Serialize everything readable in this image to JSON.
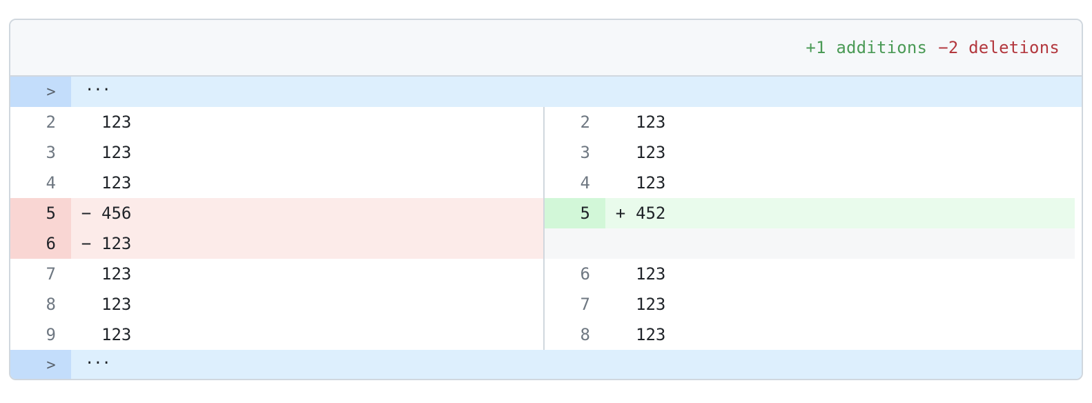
{
  "header": {
    "additions": "+1 additions",
    "deletions": "−2 deletions"
  },
  "hunk_top": {
    "expander": ">",
    "ellipsis": "···"
  },
  "hunk_bottom": {
    "expander": ">",
    "ellipsis": "···"
  },
  "left": [
    {
      "num": "2",
      "sign": "",
      "code": "123",
      "type": "context"
    },
    {
      "num": "3",
      "sign": "",
      "code": "123",
      "type": "context"
    },
    {
      "num": "4",
      "sign": "",
      "code": "123",
      "type": "context"
    },
    {
      "num": "5",
      "sign": "−",
      "code": "456",
      "type": "del"
    },
    {
      "num": "6",
      "sign": "−",
      "code": "123",
      "type": "del"
    },
    {
      "num": "7",
      "sign": "",
      "code": "123",
      "type": "context"
    },
    {
      "num": "8",
      "sign": "",
      "code": "123",
      "type": "context"
    },
    {
      "num": "9",
      "sign": "",
      "code": "123",
      "type": "context"
    }
  ],
  "right": [
    {
      "num": "2",
      "sign": "",
      "code": "123",
      "type": "context"
    },
    {
      "num": "3",
      "sign": "",
      "code": "123",
      "type": "context"
    },
    {
      "num": "4",
      "sign": "",
      "code": "123",
      "type": "context"
    },
    {
      "num": "5",
      "sign": "+",
      "code": "452",
      "type": "add"
    },
    {
      "num": "",
      "sign": "",
      "code": "",
      "type": "empty"
    },
    {
      "num": "6",
      "sign": "",
      "code": "123",
      "type": "context"
    },
    {
      "num": "7",
      "sign": "",
      "code": "123",
      "type": "context"
    },
    {
      "num": "8",
      "sign": "",
      "code": "123",
      "type": "context"
    }
  ],
  "colors": {
    "addition": "#4a9a55",
    "deletion": "#b3383e",
    "hunk": "#ddeffd"
  }
}
